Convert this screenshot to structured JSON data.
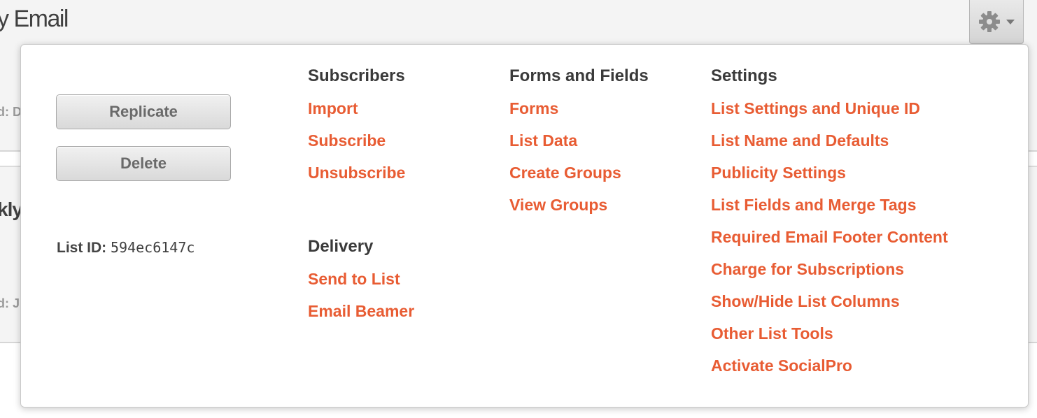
{
  "background": {
    "title": "y Email",
    "snippet_1": "d: D",
    "snippet_2": "kly",
    "snippet_3": "d: J"
  },
  "toolbar": {
    "gear_icon": "gear-icon",
    "caret_icon": "chevron-down-icon"
  },
  "actions": {
    "replicate_label": "Replicate",
    "delete_label": "Delete"
  },
  "list_id": {
    "label": "List ID:",
    "value": "594ec6147c"
  },
  "subscribers": {
    "heading": "Subscribers",
    "links": [
      "Import",
      "Subscribe",
      "Unsubscribe"
    ]
  },
  "delivery": {
    "heading": "Delivery",
    "links": [
      "Send to List",
      "Email Beamer"
    ]
  },
  "forms_fields": {
    "heading": "Forms and Fields",
    "links": [
      "Forms",
      "List Data",
      "Create Groups",
      "View Groups"
    ]
  },
  "settings": {
    "heading": "Settings",
    "links": [
      "List Settings and Unique ID",
      "List Name and Defaults",
      "Publicity Settings",
      "List Fields and Merge Tags",
      "Required Email Footer Content",
      "Charge for Subscriptions",
      "Show/Hide List Columns",
      "Other List Tools",
      "Activate SocialPro"
    ]
  },
  "colors": {
    "link": "#e85c33",
    "heading": "#3a3a3a",
    "button_text": "#6a6a6a"
  }
}
